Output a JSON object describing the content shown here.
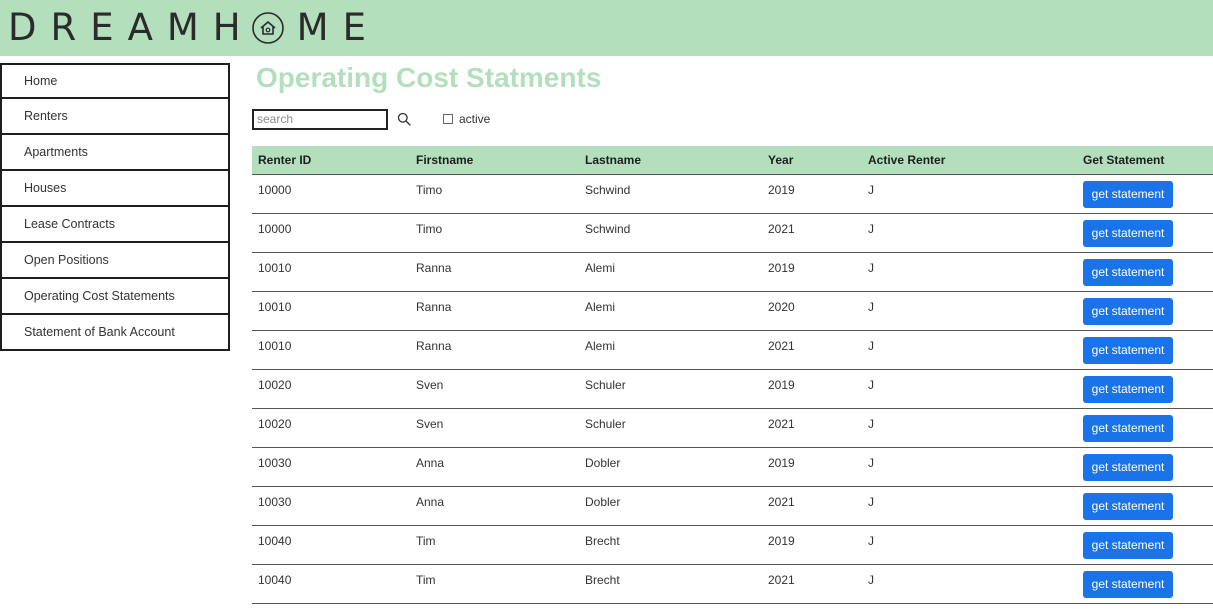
{
  "header": {
    "logo_part1": "DREAMH",
    "logo_part2": "ME",
    "logo_icon": "house-circle-icon",
    "bg_color": "#b3dfbd"
  },
  "sidebar": {
    "items": [
      {
        "label": "Home"
      },
      {
        "label": "Renters"
      },
      {
        "label": "Apartments"
      },
      {
        "label": "Houses"
      },
      {
        "label": "Lease Contracts"
      },
      {
        "label": "Open Positions"
      },
      {
        "label": "Operating Cost Statements"
      },
      {
        "label": "Statement of Bank Account"
      }
    ]
  },
  "main": {
    "title": "Operating Cost Statments",
    "search": {
      "placeholder": "search",
      "value": ""
    },
    "search_icon": "search-icon",
    "active_filter": {
      "label": "active",
      "checked": false
    },
    "accent_color": "#1a73e8",
    "table": {
      "headers": [
        "Renter ID",
        "Firstname",
        "Lastname",
        "Year",
        "Active Renter",
        "Get Statement"
      ],
      "rows": [
        {
          "renter_id": "10000",
          "firstname": "Timo",
          "lastname": "Schwind",
          "year": "2019",
          "active": "J",
          "button": "get statement"
        },
        {
          "renter_id": "10000",
          "firstname": "Timo",
          "lastname": "Schwind",
          "year": "2021",
          "active": "J",
          "button": "get statement"
        },
        {
          "renter_id": "10010",
          "firstname": "Ranna",
          "lastname": "Alemi",
          "year": "2019",
          "active": "J",
          "button": "get statement"
        },
        {
          "renter_id": "10010",
          "firstname": "Ranna",
          "lastname": "Alemi",
          "year": "2020",
          "active": "J",
          "button": "get statement"
        },
        {
          "renter_id": "10010",
          "firstname": "Ranna",
          "lastname": "Alemi",
          "year": "2021",
          "active": "J",
          "button": "get statement"
        },
        {
          "renter_id": "10020",
          "firstname": "Sven",
          "lastname": "Schuler",
          "year": "2019",
          "active": "J",
          "button": "get statement"
        },
        {
          "renter_id": "10020",
          "firstname": "Sven",
          "lastname": "Schuler",
          "year": "2021",
          "active": "J",
          "button": "get statement"
        },
        {
          "renter_id": "10030",
          "firstname": "Anna",
          "lastname": "Dobler",
          "year": "2019",
          "active": "J",
          "button": "get statement"
        },
        {
          "renter_id": "10030",
          "firstname": "Anna",
          "lastname": "Dobler",
          "year": "2021",
          "active": "J",
          "button": "get statement"
        },
        {
          "renter_id": "10040",
          "firstname": "Tim",
          "lastname": "Brecht",
          "year": "2019",
          "active": "J",
          "button": "get statement"
        },
        {
          "renter_id": "10040",
          "firstname": "Tim",
          "lastname": "Brecht",
          "year": "2021",
          "active": "J",
          "button": "get statement"
        }
      ]
    }
  }
}
